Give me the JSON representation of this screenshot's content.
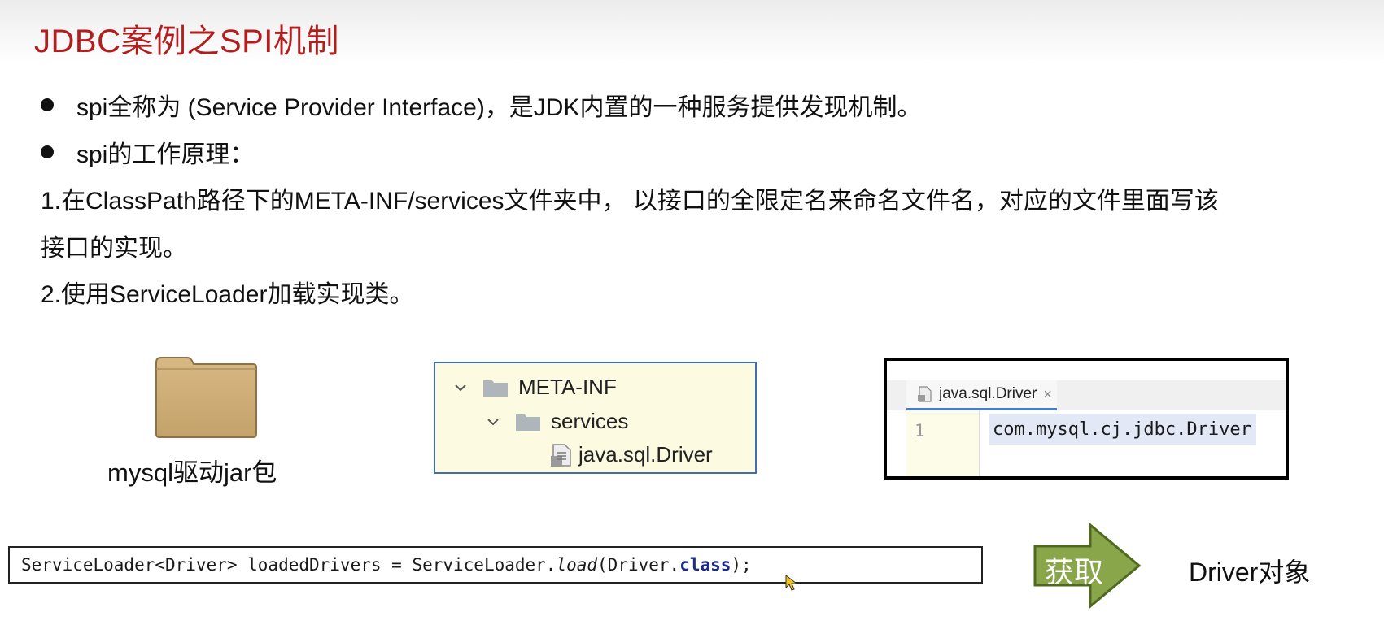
{
  "title": "JDBC案例之SPI机制",
  "bullets": [
    "spi全称为 (Service Provider Interface)，是JDK内置的一种服务提供发现机制。",
    "spi的工作原理："
  ],
  "steps": [
    "1.在ClassPath路径下的META-INF/services文件夹中， 以接口的全限定名来命名文件名，对应的文件里面写该",
    "接口的实现。",
    "2.使用ServiceLoader加载实现类。"
  ],
  "folder": {
    "icon": "folder-icon",
    "label": "mysql驱动jar包"
  },
  "tree": {
    "items": [
      {
        "label": "META-INF",
        "icon": "folder-icon",
        "expanded": true
      },
      {
        "label": "services",
        "icon": "folder-icon",
        "expanded": true
      },
      {
        "label": "java.sql.Driver",
        "icon": "file-icon"
      }
    ]
  },
  "editor": {
    "tab_label": "java.sql.Driver",
    "close_glyph": "×",
    "line_number": "1",
    "code": "com.mysql.cj.jdbc.Driver"
  },
  "code_box": {
    "part1": "ServiceLoader<Driver> loadedDrivers = ServiceLoader.",
    "method": "load",
    "part2": "(Driver.",
    "keyword": "class",
    "part3": ");"
  },
  "arrow": {
    "label": "获取",
    "color": "#8aa64a"
  },
  "result_label": "Driver对象",
  "colors": {
    "title": "#b21e1e",
    "tree_bg": "#fcfbe2",
    "tree_border": "#3f6fb0"
  }
}
